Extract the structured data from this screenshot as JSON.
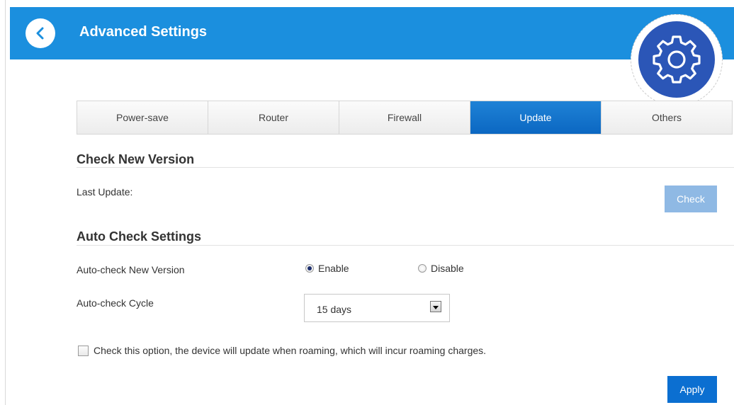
{
  "header": {
    "title": "Advanced Settings",
    "color": "#1b8fde"
  },
  "tabs": [
    {
      "label": "Power-save",
      "active": false
    },
    {
      "label": "Router",
      "active": false
    },
    {
      "label": "Firewall",
      "active": false
    },
    {
      "label": "Update",
      "active": true
    },
    {
      "label": "Others",
      "active": false
    }
  ],
  "check_version": {
    "section_title": "Check New Version",
    "last_update_label": "Last Update:",
    "check_button": "Check"
  },
  "auto_check": {
    "section_title": "Auto Check Settings",
    "new_version_label": "Auto-check New Version",
    "enable_label": "Enable",
    "disable_label": "Disable",
    "selected": "Enable",
    "cycle_label": "Auto-check Cycle",
    "cycle_value": "15 days"
  },
  "roaming": {
    "label": "Check this option, the device will update when roaming, which will incur roaming charges.",
    "checked": false
  },
  "apply_button": "Apply",
  "icons": {
    "back": "chevron-left-icon",
    "settings": "gear-icon"
  }
}
